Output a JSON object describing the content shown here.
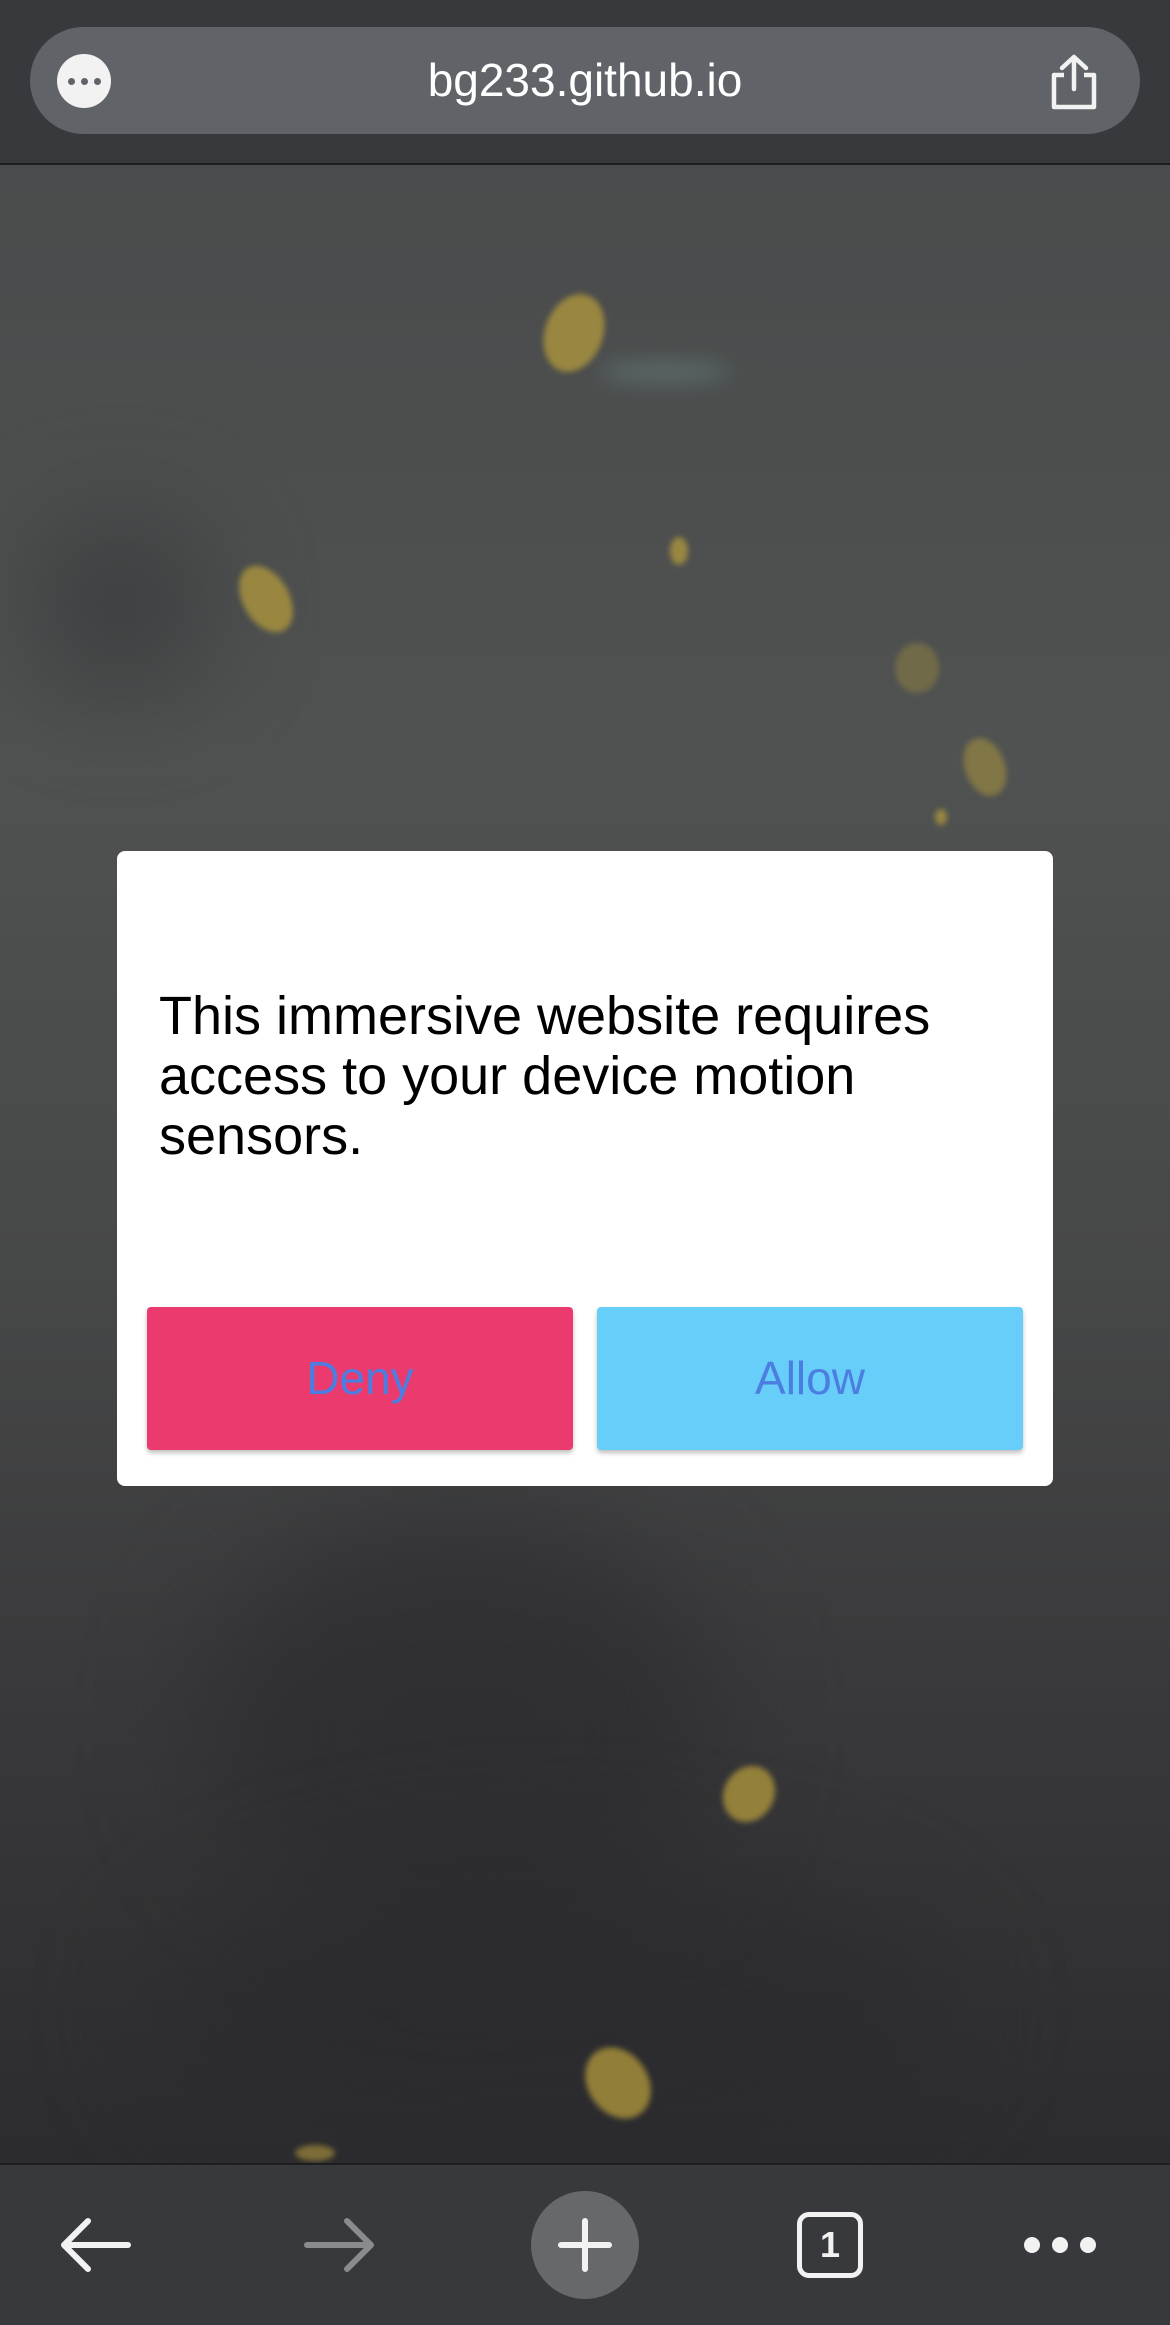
{
  "browser": {
    "url": "bg233.github.io",
    "tab_count": "1",
    "icons": {
      "page_menu": "more-horizontal-icon",
      "share": "share-icon",
      "back": "arrow-left-icon",
      "forward": "arrow-right-icon",
      "new_tab": "plus-icon",
      "tabs": "tab-count-icon",
      "menu": "more-horizontal-icon"
    }
  },
  "dialog": {
    "message": "This immersive website requires access to your device motion sensors.",
    "deny_label": "Deny",
    "allow_label": "Allow"
  },
  "colors": {
    "deny_button": "#ea3a6e",
    "allow_button": "#66cef8",
    "button_text": "#4c7de0",
    "toolbar": "#38393c"
  }
}
